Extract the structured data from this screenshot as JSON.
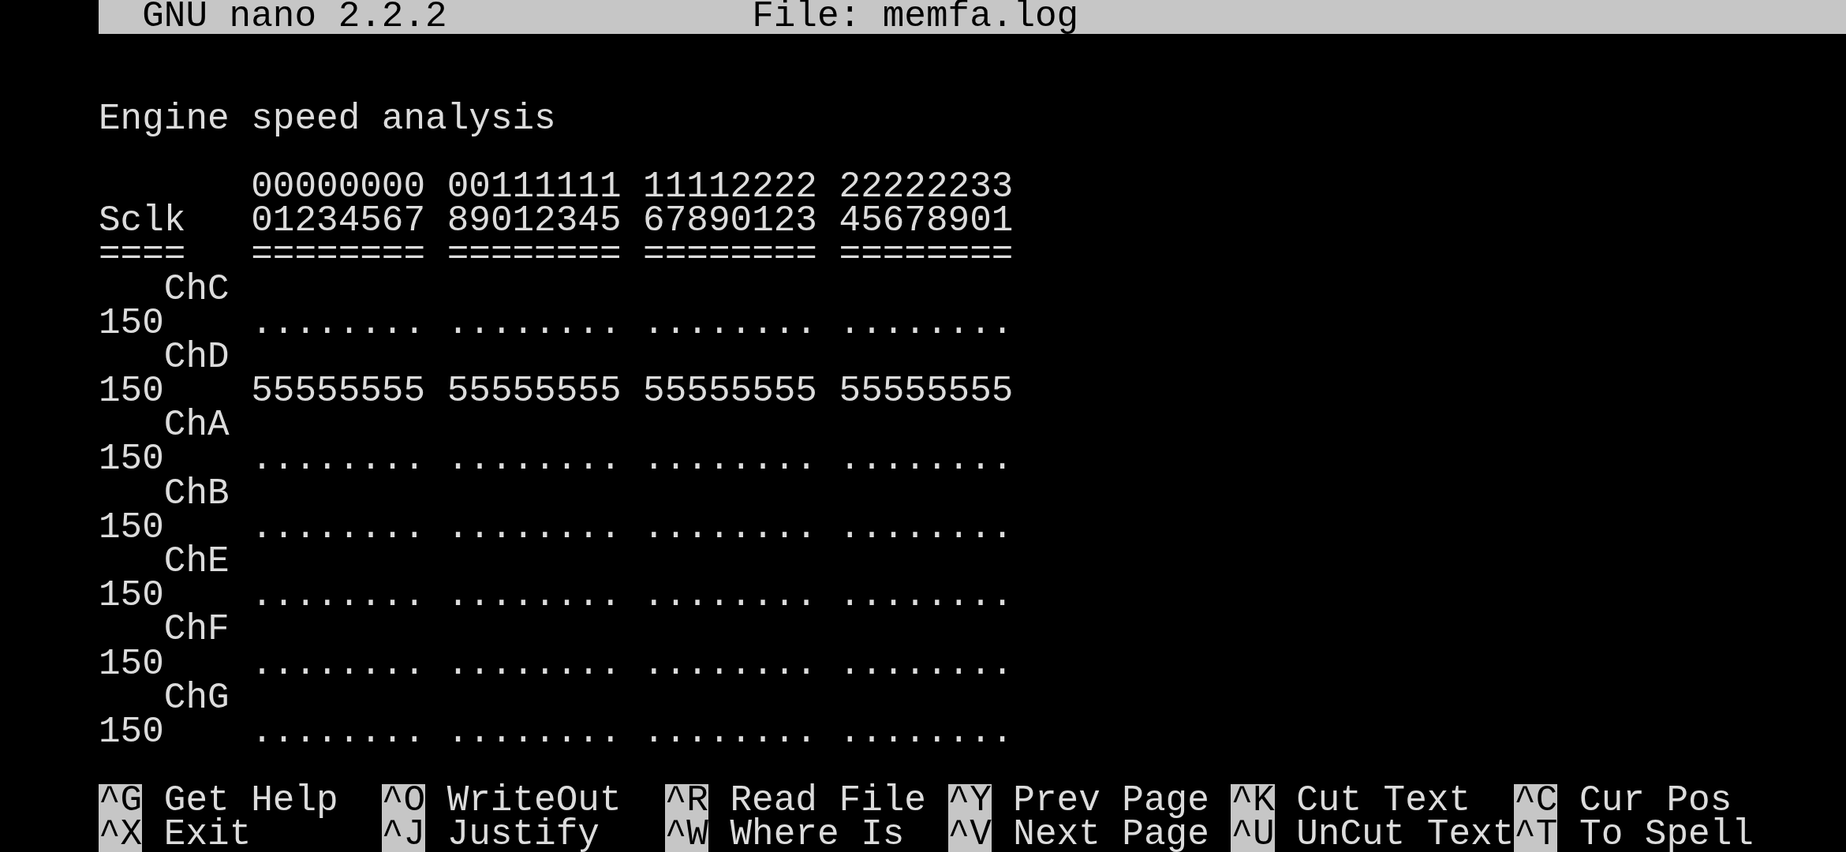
{
  "title_bar": {
    "app": "GNU nano 2.2.2",
    "file": "File: memfa.log"
  },
  "heading": "Engine speed analysis",
  "table_lines": [
    "       00000000 00111111 11112222 22222233",
    "Sclk   01234567 89012345 67890123 45678901",
    "====   ======== ======== ======== ========",
    "   ChC",
    "150    ........ ........ ........ ........",
    "   ChD",
    "150    55555555 55555555 55555555 55555555",
    "   ChA",
    "150    ........ ........ ........ ........",
    "   ChB",
    "150    ........ ........ ........ ........",
    "   ChE",
    "150    ........ ........ ........ ........",
    "   ChF",
    "150    ........ ........ ........ ........",
    "   ChG",
    "150    ........ ........ ........ ........"
  ],
  "shortcuts": [
    {
      "key": "^G",
      "label": "Get Help"
    },
    {
      "key": "^O",
      "label": "WriteOut"
    },
    {
      "key": "^R",
      "label": "Read File"
    },
    {
      "key": "^Y",
      "label": "Prev Page"
    },
    {
      "key": "^K",
      "label": "Cut Text"
    },
    {
      "key": "^C",
      "label": "Cur Pos"
    },
    {
      "key": "^X",
      "label": "Exit"
    },
    {
      "key": "^J",
      "label": "Justify"
    },
    {
      "key": "^W",
      "label": "Where Is"
    },
    {
      "key": "^V",
      "label": "Next Page"
    },
    {
      "key": "^U",
      "label": "UnCut Text"
    },
    {
      "key": "^T",
      "label": "To Spell"
    }
  ]
}
